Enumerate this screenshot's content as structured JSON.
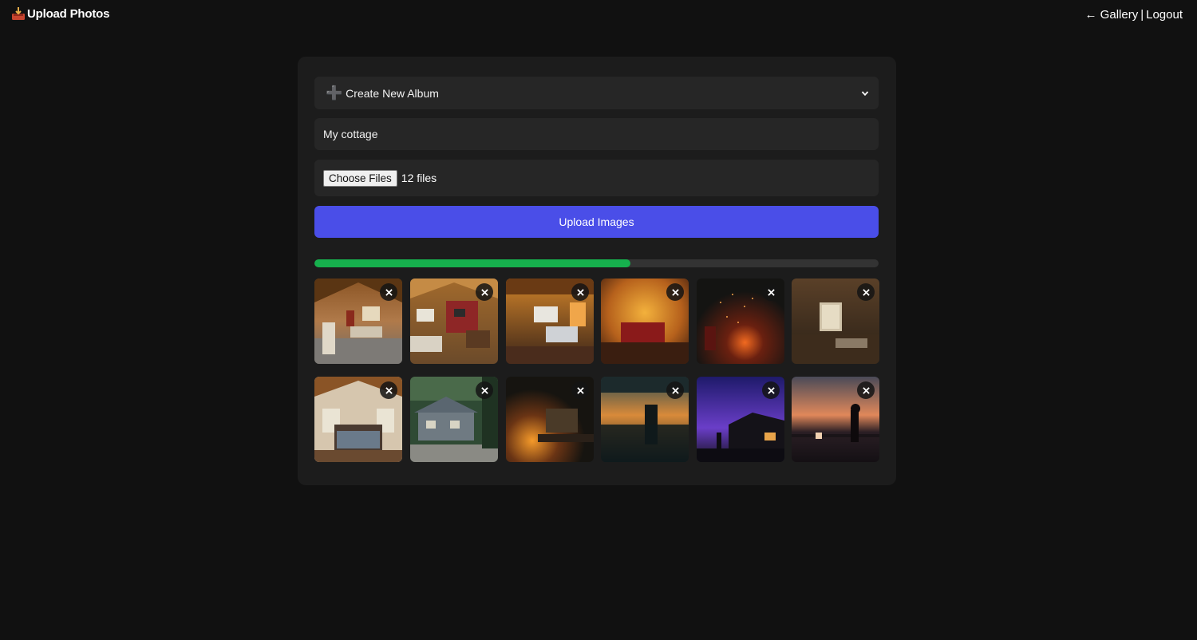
{
  "header": {
    "title": "Upload Photos",
    "icon": "inbox-tray-icon",
    "nav": {
      "gallery_label": "← Gallery",
      "separator": "|",
      "logout_label": "Logout"
    }
  },
  "form": {
    "album_select": {
      "selected": "Create New Album",
      "icon": "plus-icon",
      "plus_glyph": "➕"
    },
    "album_name": {
      "value": "My cottage"
    },
    "file_input": {
      "button_label": "Choose Files",
      "status": "12 files"
    },
    "submit_label": "Upload Images"
  },
  "progress": {
    "percent": 56,
    "color": "#16b04d"
  },
  "accent_color": "#4a4ee8",
  "thumbnails": {
    "count": 12,
    "remove_icon": "close-icon"
  }
}
